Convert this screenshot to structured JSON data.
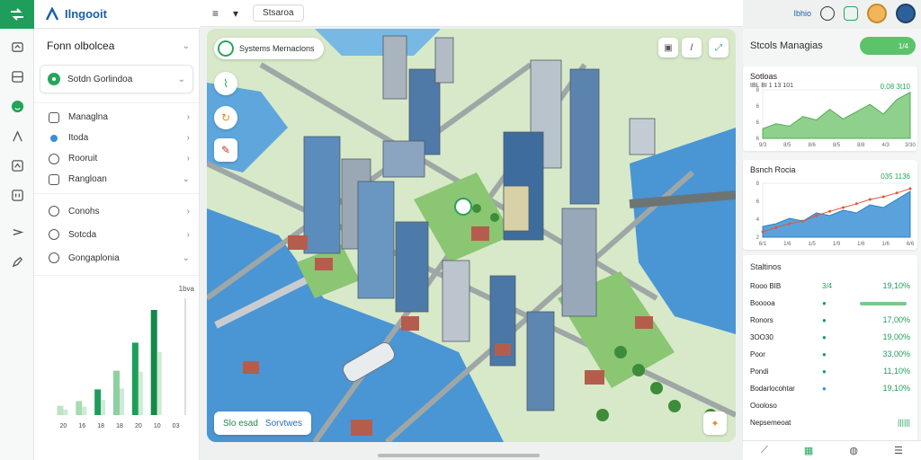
{
  "app": {
    "brand_name": "Ilngooit"
  },
  "rail": {
    "items": [
      "shuffle-icon",
      "layers-icon",
      "globe-icon",
      "flag-icon",
      "box-icon",
      "list-icon",
      "route-icon",
      "edit-icon"
    ]
  },
  "toolbar": {
    "menu_label": "≡",
    "dropdown_label": "▾",
    "pill_label": "Stsaroa"
  },
  "left_panel": {
    "title": "Fonn olbolcea",
    "select_value": "Sotdn Gorlindoa",
    "group1": [
      {
        "label": "Managlna",
        "icon": "square"
      },
      {
        "label": "Itoda",
        "icon": "dot"
      },
      {
        "label": "Rooruit",
        "icon": "round"
      },
      {
        "label": "Rangloan",
        "icon": "square"
      }
    ],
    "group2": [
      {
        "label": "Conohs",
        "icon": "round"
      },
      {
        "label": "Sotcda",
        "icon": "round"
      },
      {
        "label": "Gongaplonia",
        "icon": "round"
      }
    ],
    "chart_label": "1bva",
    "chart_ticks": [
      "20",
      "16",
      "18",
      "18",
      "20",
      "10",
      "03"
    ]
  },
  "map": {
    "chip_label": "Systems Mernaclons",
    "footer_label": "Slo esad",
    "footer_sub": "Sorvtwes"
  },
  "header_right": {
    "link_text": "Ibhio"
  },
  "right_panel": {
    "title": "Stcols Managias",
    "badge_value": "1/4",
    "card1": {
      "title": "Sotloas",
      "subtitle": "IBL BI 1 13 101",
      "value": "0.08 3t10",
      "yticks": [
        "8",
        "6",
        "6",
        "6"
      ],
      "xticks": [
        "9/3",
        "8/5",
        "8/6",
        "8/5",
        "8/8",
        "4/3",
        "3/30"
      ]
    },
    "card2": {
      "title": "Bsnch Rocia",
      "value": "035 1136",
      "yticks": [
        "8",
        "6",
        "4",
        "2"
      ],
      "xticks": [
        "6/1",
        "1/6",
        "1/5",
        "1/9",
        "1/6",
        "1/6",
        "6/6"
      ]
    },
    "stats": {
      "title": "Staltinos",
      "rows": [
        {
          "label": "Rooo BIB",
          "mid": "3/4",
          "right": "19,10%"
        },
        {
          "label": "Booooa",
          "mid": "●",
          "right": ""
        },
        {
          "label": "Ronors",
          "mid": "●",
          "right": "17,00%"
        },
        {
          "label": "3OO30",
          "mid": "●",
          "right": "19,00%"
        },
        {
          "label": "Poor",
          "mid": "●",
          "right": "33,00%"
        },
        {
          "label": "Pondi",
          "mid": "●",
          "right": "11,10%"
        },
        {
          "label": "Bodarlocohtar",
          "mid": "●",
          "right": "19,10%"
        },
        {
          "label": "Oooloso",
          "mid": "",
          "right": ""
        },
        {
          "label": "Nepsemeoat",
          "mid": "",
          "right": "||||||"
        }
      ]
    }
  },
  "chart_data": [
    {
      "type": "bar",
      "title": "",
      "categories": [
        "20",
        "16",
        "18",
        "18",
        "20",
        "10",
        "03"
      ],
      "values": [
        8,
        12,
        22,
        38,
        62,
        90,
        0
      ],
      "ylim": [
        0,
        100
      ]
    },
    {
      "type": "area",
      "title": "Sotloas",
      "x": [
        "9/3",
        "8/5",
        "8/6",
        "8/5",
        "8/8",
        "4/3",
        "3/30"
      ],
      "values": [
        20,
        30,
        25,
        45,
        38,
        60,
        40,
        55,
        70,
        50,
        80,
        95
      ],
      "ylim": [
        0,
        100
      ]
    },
    {
      "type": "area",
      "title": "Bsnch Rocia",
      "x": [
        "6/1",
        "1/6",
        "1/5",
        "1/9",
        "1/6",
        "1/6",
        "6/6"
      ],
      "values": [
        20,
        25,
        35,
        30,
        45,
        40,
        50,
        45,
        60,
        55,
        70,
        85
      ],
      "line": [
        10,
        18,
        25,
        30,
        40,
        48,
        55,
        62,
        70,
        75,
        82,
        90
      ],
      "ylim": [
        0,
        100
      ]
    }
  ]
}
